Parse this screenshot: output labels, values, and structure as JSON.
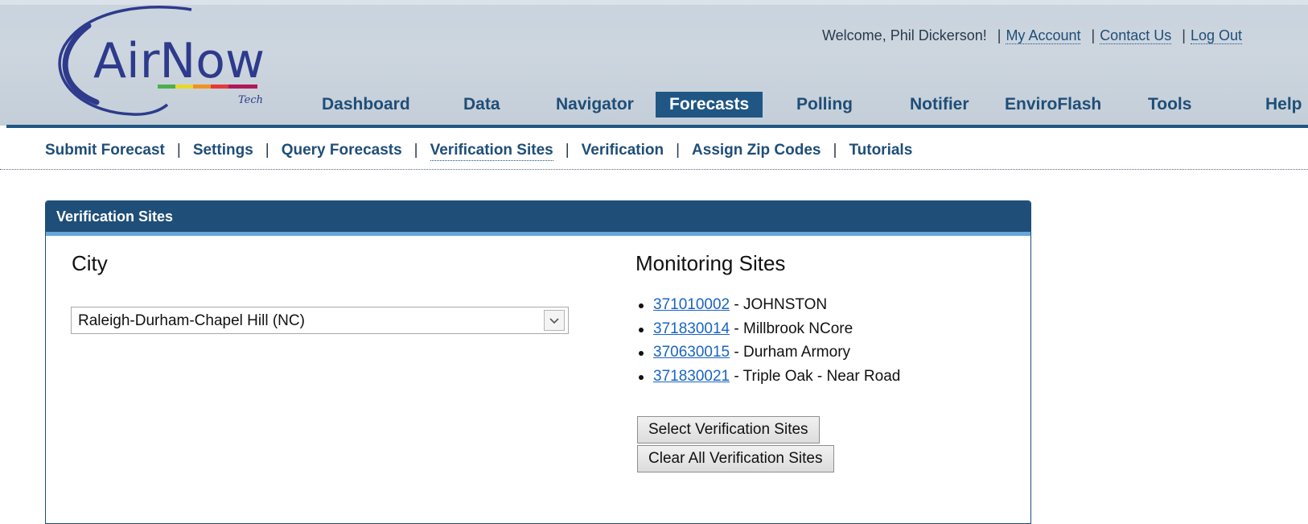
{
  "brand": {
    "logo_text": "AirNow",
    "logo_sub": "Tech",
    "colors": {
      "primary": "#1f4e78",
      "accent_bar": "#67a6d8",
      "link": "#1a64c2"
    }
  },
  "user_bar": {
    "welcome": "Welcome, Phil Dickerson!",
    "links": [
      "My Account",
      "Contact Us",
      "Log Out"
    ],
    "separator": "|"
  },
  "main_nav": {
    "items": [
      "Dashboard",
      "Data",
      "Navigator",
      "Forecasts",
      "Polling",
      "Notifier",
      "EnviroFlash",
      "Tools",
      "Help"
    ],
    "active": "Forecasts"
  },
  "sub_nav": {
    "items": [
      "Submit Forecast",
      "Settings",
      "Query Forecasts",
      "Verification Sites",
      "Verification",
      "Assign Zip Codes",
      "Tutorials"
    ],
    "current": "Verification Sites",
    "separator": "|"
  },
  "panel": {
    "title": "Verification Sites",
    "city_heading": "City",
    "city_select": {
      "value": "Raleigh-Durham-Chapel Hill (NC)",
      "icon": "chevron-down-icon"
    },
    "sites_heading": "Monitoring Sites",
    "sites": [
      {
        "code": "371010002",
        "name": "JOHNSTON"
      },
      {
        "code": "371830014",
        "name": "Millbrook NCore"
      },
      {
        "code": "370630015",
        "name": "Durham Armory"
      },
      {
        "code": "371830021",
        "name": "Triple Oak - Near Road"
      }
    ],
    "name_prefix": " - ",
    "buttons": {
      "select": "Select Verification Sites",
      "clear": "Clear All Verification Sites"
    }
  }
}
